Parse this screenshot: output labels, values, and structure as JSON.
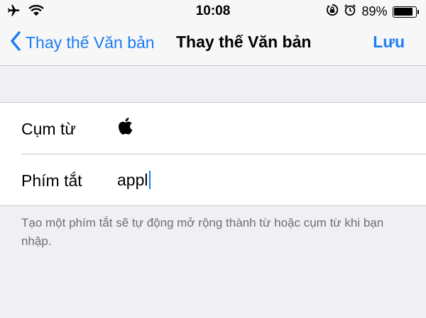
{
  "status_bar": {
    "time": "10:08",
    "battery_percent": "89%",
    "battery_level": 0.89,
    "icons": [
      "airplane-icon",
      "wifi-icon",
      "orientation-lock-icon",
      "alarm-icon",
      "alarm-clock-icon",
      "battery-icon"
    ]
  },
  "nav": {
    "back_label": "Thay thế Văn bản",
    "title": "Thay thế Văn bản",
    "save_label": "Lưu"
  },
  "form": {
    "phrase_label": "Cụm từ",
    "phrase_value_icon": "apple-logo-icon",
    "shortcut_label": "Phím tắt",
    "shortcut_value": "appl"
  },
  "footer": {
    "note": "Tạo một phím tắt sẽ tự động mở rộng thành từ hoặc cụm từ khi bạn nhập."
  },
  "colors": {
    "accent": "#1b7cf5",
    "background": "#efeff4",
    "separator": "#c8c7cc",
    "secondary_text": "#6d6d72"
  }
}
